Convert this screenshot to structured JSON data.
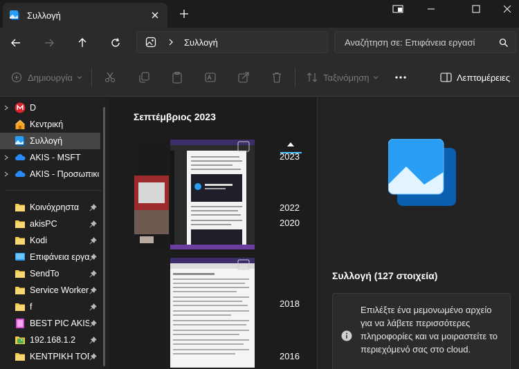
{
  "tab": {
    "title": "Συλλογή"
  },
  "address": {
    "location": "Συλλογή"
  },
  "search": {
    "placeholder": "Αναζήτηση σε: Επιφάνεια εργασί"
  },
  "commandbar": {
    "new_label": "Δημιουργία",
    "sort_label": "Ταξινόμηση",
    "details_label": "Λεπτομέρειες"
  },
  "sidebar": {
    "items": [
      {
        "label": "D",
        "icon": "mega-icon"
      },
      {
        "label": "Κεντρική",
        "icon": "home-icon"
      },
      {
        "label": "Συλλογή",
        "icon": "gallery-icon"
      },
      {
        "label": "AKIS - MSFT",
        "icon": "onedrive-icon"
      },
      {
        "label": "AKIS - Προσωπικό",
        "icon": "onedrive-icon"
      },
      {
        "label": "Κοινόχρηστα",
        "icon": "folder-icon"
      },
      {
        "label": "akisPC",
        "icon": "folder-icon"
      },
      {
        "label": "Kodi",
        "icon": "folder-icon"
      },
      {
        "label": "Επιφάνεια εργασ",
        "icon": "desktop-icon"
      },
      {
        "label": "SendTo",
        "icon": "folder-icon"
      },
      {
        "label": "Service Worker",
        "icon": "folder-icon"
      },
      {
        "label": "f",
        "icon": "folder-icon"
      },
      {
        "label": "BEST PIC AKIS",
        "icon": "pink-folder-icon"
      },
      {
        "label": "192.168.1.2",
        "icon": "image-folder-icon"
      },
      {
        "label": "ΚΕΝΤΡΙΚΗ ΤΟΠΟ",
        "icon": "folder-icon"
      }
    ]
  },
  "gallery": {
    "month": "Σεπτέμβριος 2023",
    "timeline": [
      "2023",
      "2022",
      "2020",
      "2018",
      "2016"
    ]
  },
  "details": {
    "title": "Συλλογή (127 στοιχεία)",
    "info": "Επιλέξτε ένα μεμονωμένο αρχείο για να λάβετε περισσότερες πληροφορίες και να μοιραστείτε το περιεχόμενό σας στο cloud."
  },
  "colors": {
    "accent": "#4cc2ff",
    "gallery_blue": "#1e90e0",
    "folder_yellow": "#f2c94c"
  }
}
